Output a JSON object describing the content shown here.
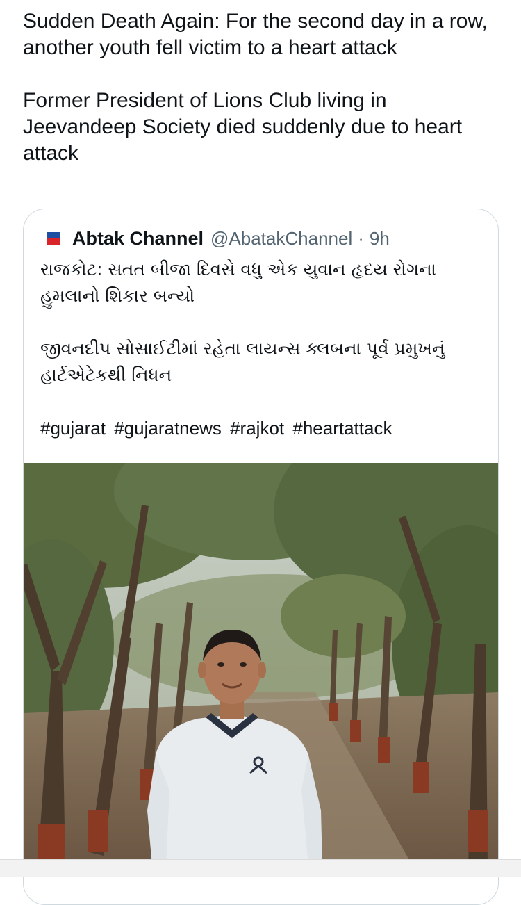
{
  "tweet": {
    "paragraphs": [
      "Sudden Death Again: For the second day in a row, another youth fell victim to a heart attack",
      "Former President of Lions Club living in Jeevandeep Society died suddenly due to heart attack"
    ]
  },
  "quoted_tweet": {
    "author_name": "Abtak Channel",
    "handle": "@AbatakChannel",
    "separator": "·",
    "time": "9h",
    "body_paragraphs": [
      "રાજકોટ: સતત બીજા દિવસે વધુ એક યુવાન હૃદય રોગના હુમલાનો શિકાર બન્યો",
      "જીવનદીપ સોસાઈટીમાં રહેતા લાયન્સ ક્લબના પૂર્વ પ્રમુખનું હાર્ટએટેકથી નિધન"
    ],
    "hashtags": [
      "#gujarat",
      "#gujaratnews",
      "#rajkot",
      "#heartattack"
    ],
    "avatar_icon": "abtak-logo-icon",
    "image": {
      "icon": "photo-man-in-wooded-path",
      "colors": {
        "sky": "#cfd6cf",
        "canopy": "#56683e",
        "ground": "#7a6650",
        "trunk": "#4a3a2c",
        "shirt": "#e8ecef",
        "skin": "#b07a5a"
      }
    }
  },
  "colors": {
    "text": "#0f1419",
    "muted": "#536471",
    "border": "#cfd9de"
  }
}
